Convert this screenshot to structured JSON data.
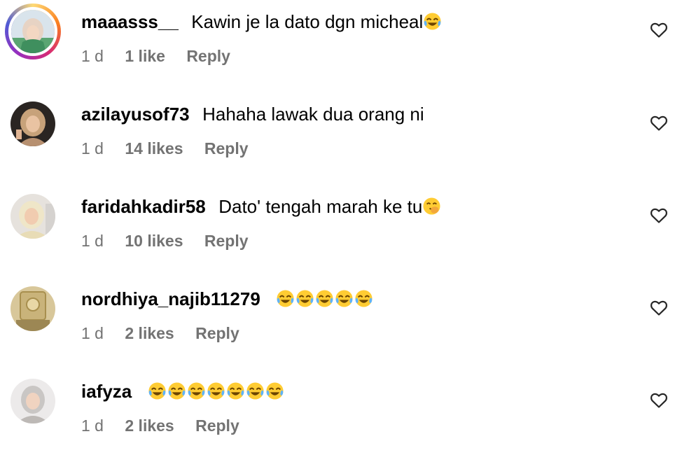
{
  "comments": [
    {
      "username": "maaasss__",
      "text": "Kawin je la dato dgn micheal",
      "emojis": [
        "face-with-tears-of-joy"
      ],
      "time": "1 d",
      "likes": "1 like",
      "reply": "Reply",
      "avatar_story_ring": true
    },
    {
      "username": "azilayusof73",
      "text": "Hahaha lawak dua orang ni",
      "emojis": [],
      "time": "1 d",
      "likes": "14 likes",
      "reply": "Reply"
    },
    {
      "username": "faridahkadir58",
      "text": "Dato' tengah marah ke tu",
      "emojis": [
        "face-with-hand-over-mouth"
      ],
      "time": "1 d",
      "likes": "10 likes",
      "reply": "Reply"
    },
    {
      "username": "nordhiya_najib11279",
      "text": "",
      "emojis": [
        "face-with-tears-of-joy",
        "face-with-tears-of-joy",
        "face-with-tears-of-joy",
        "face-with-tears-of-joy",
        "face-with-tears-of-joy"
      ],
      "time": "1 d",
      "likes": "2 likes",
      "reply": "Reply"
    },
    {
      "username": "iafyza",
      "text": "",
      "emojis": [
        "face-with-tears-of-joy",
        "face-with-tears-of-joy",
        "face-with-tears-of-joy",
        "face-with-tears-of-joy",
        "face-with-tears-of-joy",
        "face-with-tears-of-joy",
        "face-with-tears-of-joy"
      ],
      "time": "1 d",
      "likes": "2 likes",
      "reply": "Reply"
    }
  ],
  "colors": {
    "meta_text": "#737373",
    "primary_text": "#000000",
    "heart_stroke": "#262626",
    "emoji_yellow": "#ffcc33",
    "emoji_tears": "#5db3ff"
  },
  "icons": {
    "like": "heart-outline-icon"
  }
}
